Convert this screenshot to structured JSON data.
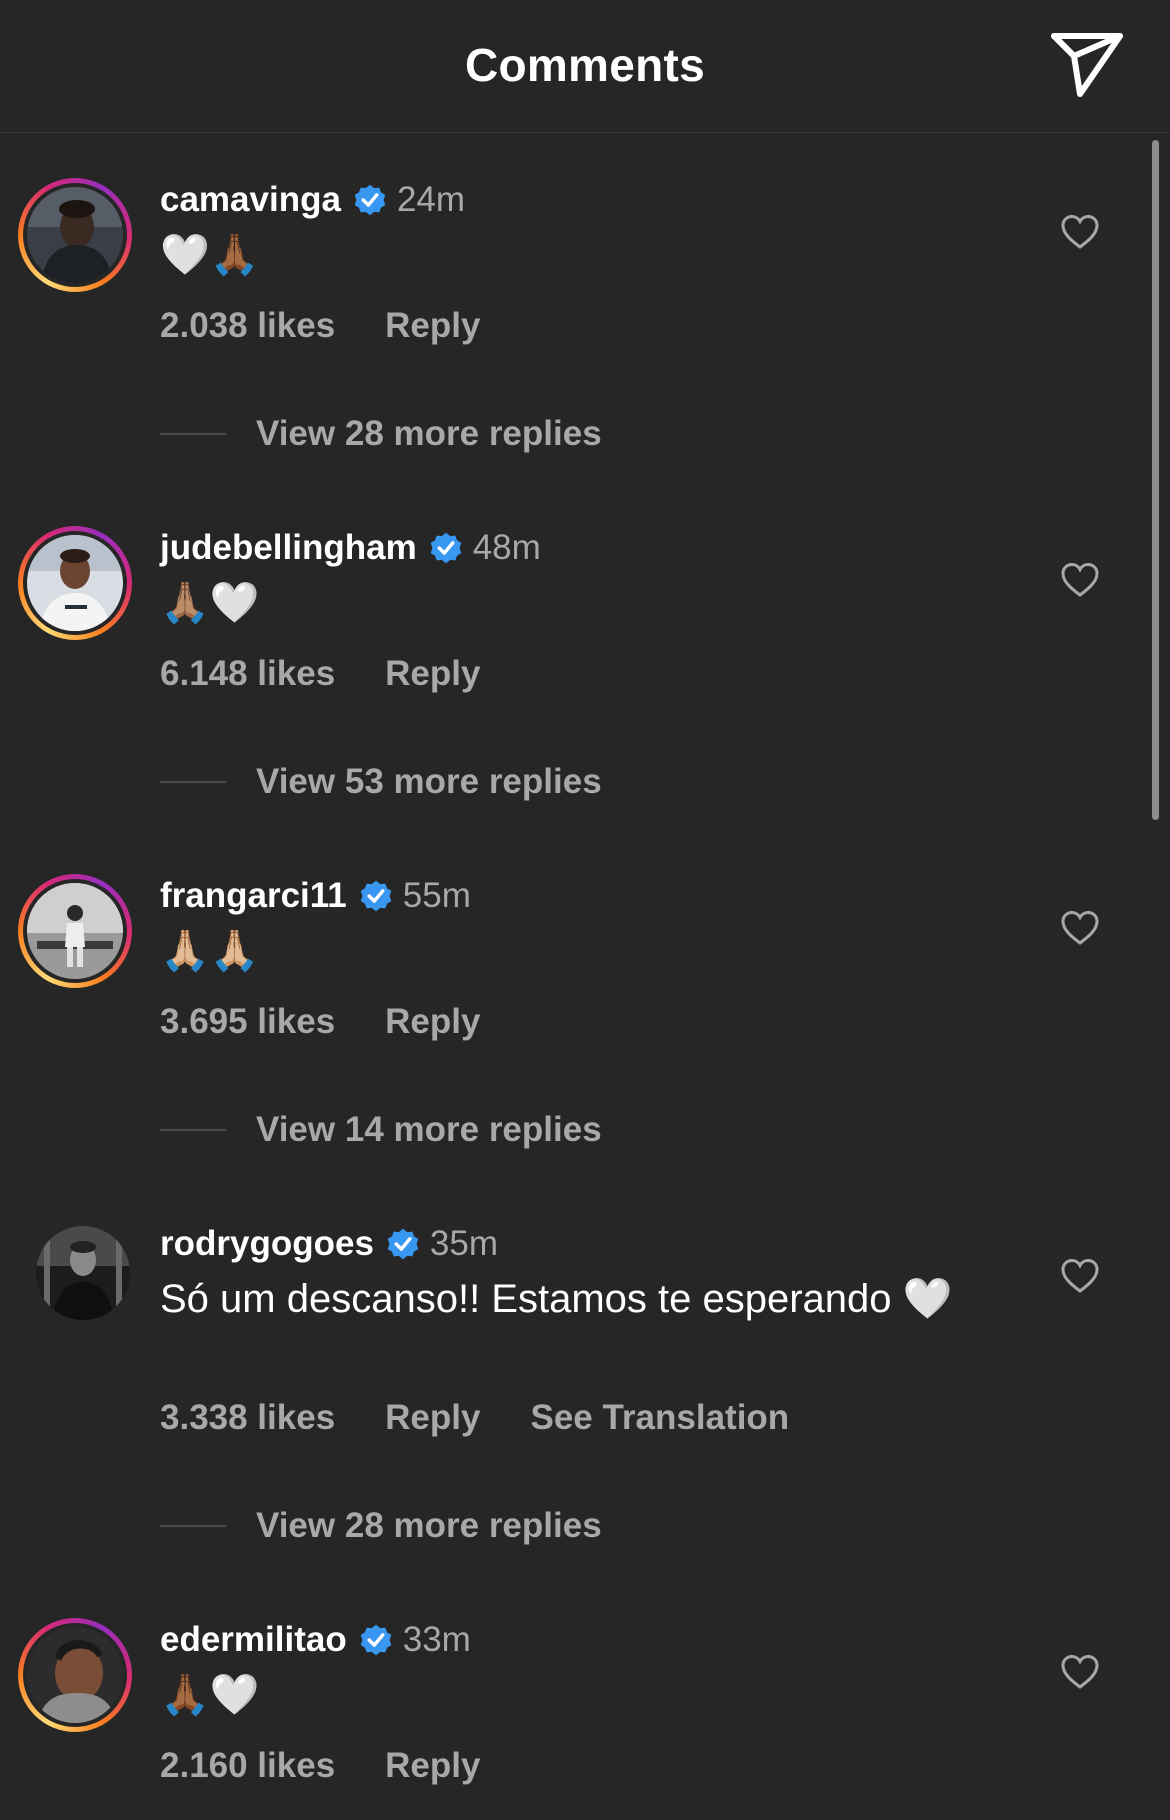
{
  "header": {
    "title": "Comments",
    "share_icon": "paper-plane-icon"
  },
  "colors": {
    "background": "#262626",
    "text": "#ffffff",
    "secondary_text": "#a8a8a8",
    "verified_badge": "#3897f0",
    "story_ring": [
      "#feda75",
      "#fa7e1e",
      "#d62976",
      "#962fbf"
    ]
  },
  "comments": [
    {
      "username": "camavinga",
      "verified": true,
      "time": "24m",
      "text": "🤍🙏🏾",
      "likes": "2.038 likes",
      "reply": "Reply",
      "view_replies": "View 28 more replies"
    },
    {
      "username": "judebellingham",
      "verified": true,
      "time": "48m",
      "text": "🙏🏽🤍",
      "likes": "6.148 likes",
      "reply": "Reply",
      "view_replies": "View 53 more replies"
    },
    {
      "username": "frangarci11",
      "verified": true,
      "time": "55m",
      "text": "🙏🏼🙏🏼",
      "likes": "3.695 likes",
      "reply": "Reply",
      "view_replies": "View 14 more replies"
    },
    {
      "username": "rodrygogoes",
      "verified": true,
      "time": "35m",
      "text": "Só um descanso!! Estamos te esperando 🤍",
      "likes": "3.338 likes",
      "reply": "Reply",
      "see_translation": "See Translation",
      "view_replies": "View 28 more replies"
    },
    {
      "username": "edermilitao",
      "verified": true,
      "time": "33m",
      "text": "🙏🏾🤍",
      "likes": "2.160 likes",
      "reply": "Reply"
    }
  ]
}
